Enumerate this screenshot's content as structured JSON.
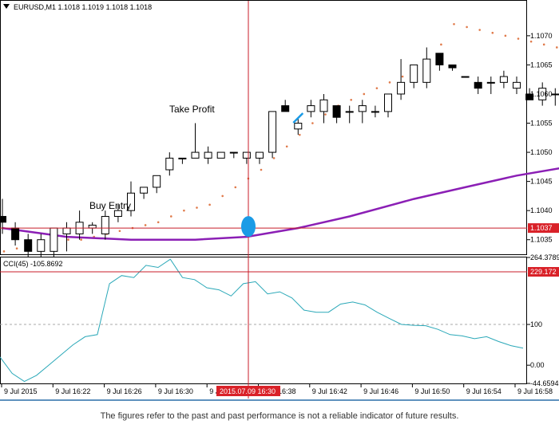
{
  "chart_data": [
    {
      "type": "candlestick",
      "title": "EURUSD,M1  1.1018 1.1019 1.1018 1.1018",
      "symbol": "EURUSD",
      "timeframe": "M1",
      "ylim": [
        1.10325,
        1.1076
      ],
      "y_ticks": [
        "1.1070",
        "1.1065",
        "1.1060",
        "1.1055",
        "1.1050",
        "1.1045",
        "1.1040",
        "1.1035"
      ],
      "candles": [
        {
          "o": 1.1039,
          "h": 1.1042,
          "l": 1.1036,
          "c": 1.1038
        },
        {
          "o": 1.1037,
          "h": 1.1038,
          "l": 1.1034,
          "c": 1.1035
        },
        {
          "o": 1.1035,
          "h": 1.1036,
          "l": 1.1032,
          "c": 1.1033
        },
        {
          "o": 1.1033,
          "h": 1.1036,
          "l": 1.1032,
          "c": 1.1035
        },
        {
          "o": 1.1033,
          "h": 1.1037,
          "l": 1.1032,
          "c": 1.1037
        },
        {
          "o": 1.1036,
          "h": 1.1038,
          "l": 1.1033,
          "c": 1.1037
        },
        {
          "o": 1.1036,
          "h": 1.104,
          "l": 1.1035,
          "c": 1.1038
        },
        {
          "o": 1.1037,
          "h": 1.1038,
          "l": 1.1036,
          "c": 1.10375
        },
        {
          "o": 1.1036,
          "h": 1.104,
          "l": 1.1035,
          "c": 1.1039
        },
        {
          "o": 1.1039,
          "h": 1.1041,
          "l": 1.1038,
          "c": 1.104
        },
        {
          "o": 1.104,
          "h": 1.1045,
          "l": 1.1039,
          "c": 1.1043
        },
        {
          "o": 1.1043,
          "h": 1.1044,
          "l": 1.1042,
          "c": 1.1044
        },
        {
          "o": 1.1044,
          "h": 1.1046,
          "l": 1.1043,
          "c": 1.1046
        },
        {
          "o": 1.1047,
          "h": 1.105,
          "l": 1.1046,
          "c": 1.1049
        },
        {
          "o": 1.1049,
          "h": 1.1049,
          "l": 1.1048,
          "c": 1.1049
        },
        {
          "o": 1.1049,
          "h": 1.1055,
          "l": 1.1049,
          "c": 1.105
        },
        {
          "o": 1.1049,
          "h": 1.1051,
          "l": 1.1048,
          "c": 1.105
        },
        {
          "o": 1.1049,
          "h": 1.105,
          "l": 1.1049,
          "c": 1.105
        },
        {
          "o": 1.105,
          "h": 1.105,
          "l": 1.1049,
          "c": 1.105
        },
        {
          "o": 1.1049,
          "h": 1.105,
          "l": 1.1048,
          "c": 1.105
        },
        {
          "o": 1.1049,
          "h": 1.105,
          "l": 1.1048,
          "c": 1.105
        },
        {
          "o": 1.105,
          "h": 1.1057,
          "l": 1.1049,
          "c": 1.1057
        },
        {
          "o": 1.1058,
          "h": 1.1059,
          "l": 1.1057,
          "c": 1.1057
        },
        {
          "o": 1.1054,
          "h": 1.1056,
          "l": 1.1053,
          "c": 1.1055
        },
        {
          "o": 1.1057,
          "h": 1.1059,
          "l": 1.1056,
          "c": 1.1058
        },
        {
          "o": 1.1057,
          "h": 1.106,
          "l": 1.1055,
          "c": 1.1059
        },
        {
          "o": 1.1058,
          "h": 1.1058,
          "l": 1.1055,
          "c": 1.1056
        },
        {
          "o": 1.1057,
          "h": 1.1058,
          "l": 1.1055,
          "c": 1.1057
        },
        {
          "o": 1.1057,
          "h": 1.1059,
          "l": 1.1055,
          "c": 1.1058
        },
        {
          "o": 1.1057,
          "h": 1.1058,
          "l": 1.1056,
          "c": 1.1057
        },
        {
          "o": 1.1057,
          "h": 1.106,
          "l": 1.1056,
          "c": 1.106
        },
        {
          "o": 1.106,
          "h": 1.1066,
          "l": 1.1059,
          "c": 1.1062
        },
        {
          "o": 1.1062,
          "h": 1.1065,
          "l": 1.1061,
          "c": 1.1065
        },
        {
          "o": 1.1062,
          "h": 1.1068,
          "l": 1.1061,
          "c": 1.1066
        },
        {
          "o": 1.1067,
          "h": 1.1067,
          "l": 1.1064,
          "c": 1.1065
        },
        {
          "o": 1.1065,
          "h": 1.1065,
          "l": 1.1064,
          "c": 1.10645
        },
        {
          "o": 1.1063,
          "h": 1.1063,
          "l": 1.1063,
          "c": 1.1063
        },
        {
          "o": 1.1062,
          "h": 1.1063,
          "l": 1.106,
          "c": 1.1061
        },
        {
          "o": 1.1062,
          "h": 1.1063,
          "l": 1.106,
          "c": 1.1062
        },
        {
          "o": 1.1062,
          "h": 1.1064,
          "l": 1.1061,
          "c": 1.1063
        },
        {
          "o": 1.1061,
          "h": 1.1063,
          "l": 1.106,
          "c": 1.1062
        },
        {
          "o": 1.106,
          "h": 1.1061,
          "l": 1.1059,
          "c": 1.1059
        },
        {
          "o": 1.1059,
          "h": 1.1062,
          "l": 1.1058,
          "c": 1.1061
        },
        {
          "o": 1.106,
          "h": 1.1061,
          "l": 1.1058,
          "c": 1.106
        },
        {
          "o": 1.1058,
          "h": 1.106,
          "l": 1.1057,
          "c": 1.1058
        },
        {
          "o": 1.1058,
          "h": 1.1063,
          "l": 1.1058,
          "c": 1.1062
        },
        {
          "o": 1.1063,
          "h": 1.1063,
          "l": 1.1058,
          "c": 1.1058
        },
        {
          "o": 1.1058,
          "h": 1.1058,
          "l": 1.1056,
          "c": 1.1057
        },
        {
          "o": 1.1055,
          "h": 1.1059,
          "l": 1.1054,
          "c": 1.1059
        }
      ],
      "moving_average": {
        "color": "#8b1fb5",
        "points": [
          [
            0,
            1.1037
          ],
          [
            5,
            1.10355
          ],
          [
            10,
            1.1035
          ],
          [
            15,
            1.1035
          ],
          [
            19,
            1.10355
          ],
          [
            23,
            1.1037
          ],
          [
            27,
            1.1039
          ],
          [
            32,
            1.1042
          ],
          [
            36,
            1.1044
          ],
          [
            40,
            1.1046
          ],
          [
            44,
            1.10475
          ],
          [
            48,
            1.1049
          ]
        ]
      },
      "parabolic_sar": {
        "color": "#e07a4a",
        "start_index": 0,
        "values": [
          1.1033,
          1.10335,
          1.10335,
          1.1034,
          1.10345,
          1.1035,
          1.1035,
          1.10355,
          1.1036,
          1.10365,
          1.1037,
          1.10375,
          1.1038,
          1.1039,
          1.104,
          1.10405,
          1.1041,
          1.10425,
          1.1044,
          1.10455,
          1.1047,
          1.1049,
          1.1051,
          1.1053,
          1.1055,
          1.10565,
          1.1058,
          1.1059,
          1.106,
          1.1061,
          1.1062,
          1.1063,
          1.1064,
          1.10655,
          1.10685,
          1.1072,
          1.10715,
          1.1071,
          1.10705,
          1.107,
          1.10695,
          1.1069,
          1.10685,
          1.1068,
          1.10675,
          1.10665,
          1.10655
        ]
      },
      "buy_entry_index": 20,
      "take_profit_index": 23,
      "current_price_label": "1.1037",
      "current_price": 1.1037,
      "colors": {
        "crosshair": "#c81e2a",
        "price_tag": "#d92128",
        "entry_marker": "#1b9be6",
        "take_profit_marker": "#1b9be6",
        "candle_up": "#ffffff",
        "candle_down": "#000000"
      }
    },
    {
      "type": "line",
      "title": "CCI(45) -105.8692",
      "ylim": [
        -44.6594,
        264.3789
      ],
      "y_ticks": [
        "264.3789",
        "100",
        "0.00",
        "-44.6594"
      ],
      "level_lines": [
        100
      ],
      "series": [
        {
          "color": "#2aa8b8",
          "values": [
            20,
            -20,
            -40,
            -25,
            0,
            25,
            50,
            70,
            75,
            200,
            220,
            215,
            245,
            240,
            260,
            215,
            210,
            190,
            185,
            170,
            200,
            205,
            175,
            180,
            165,
            135,
            130,
            130,
            150,
            155,
            148,
            130,
            115,
            100,
            98,
            97,
            88,
            75,
            72,
            65,
            70,
            58,
            48,
            42
          ]
        }
      ],
      "level_marker": 229.172,
      "level_marker_label": "229.172"
    }
  ],
  "x_axis": {
    "labels": [
      "9 Jul 2015",
      "9 Jul 16:22",
      "9 Jul 16:26",
      "9 Jul 16:30",
      "9 Jul 16:34",
      "9 Jul 16:38",
      "9 Jul 16:42",
      "9 Jul 16:46",
      "9 Jul 16:50",
      "9 Jul 16:54",
      "9 Jul 16:58"
    ],
    "crosshair_label": "2015.07.09 16:30"
  },
  "annotations": {
    "buy_entry": "Buy Entry",
    "take_profit": "Take Profit"
  },
  "disclaimer": "The figures refer to the past and past performance is not a reliable indicator of future results."
}
